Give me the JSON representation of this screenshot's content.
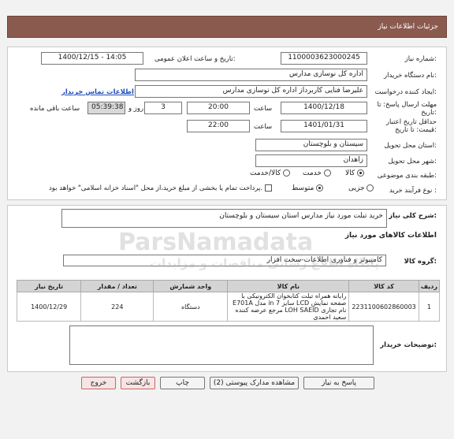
{
  "header": {
    "title": "جزئیات اطلاعات نیاز"
  },
  "form": {
    "need_number_label": "شماره نیاز:",
    "need_number": "1100003623000245",
    "announce_label": "تاریخ و ساعت اعلان عمومی:",
    "announce_value": "1400/12/15 - 14:05",
    "buyer_org_label": "نام دستگاه خریدار:",
    "buyer_org": "اداره کل نوسازی مدارس",
    "requester_label": "ایجاد کننده درخواست:",
    "requester": "علیرضا فنایی کاربرداز اداره کل نوسازی مدارس",
    "contact_link": "اطلاعات تماس خریدار",
    "deadline_label_1": "مهلت ارسال پاسخ: تا",
    "deadline_label_2": "تاریخ:",
    "deadline_date": "1400/12/18",
    "time_label": "ساعت",
    "deadline_time": "20:00",
    "days_value": "3",
    "days_and": "روز و",
    "remaining_time": "05:39:38",
    "remaining_label": "ساعت باقی مانده",
    "validity_label_1": "حداقل تاریخ اعتبار",
    "validity_label_2": "قیمت: تا تاریخ:",
    "validity_date": "1401/01/31",
    "validity_time": "22:00",
    "province_label": "استان محل تحویل:",
    "province": "سیستان و بلوچستان",
    "city_label": "شهر محل تحویل:",
    "city": "زاهدان",
    "category_label": "طبقه بندی موضوعی:",
    "category_options": [
      "کالا",
      "خدمت",
      "کالا/خدمت"
    ],
    "process_label": "نوع فرآیند خرید :",
    "process_options": [
      "جزیی",
      "متوسط"
    ],
    "payment_note": "پرداخت تمام یا بخشی از مبلغ خرید،از محل \"اسناد خزانه اسلامی\" خواهد بود."
  },
  "summary": {
    "label": "شرح کلی نیاز:",
    "text": "خرید تبلت مورد نیاز مدارس استان سیستان و بلوچستان"
  },
  "goods": {
    "section_title": "اطلاعات کالاهای مورد نیاز",
    "group_label": "گروه کالا:",
    "group_value": "کامپیوتر و فناوری اطلاعات-سخت افزار",
    "columns": [
      "ردیف",
      "کد کالا",
      "نام کالا",
      "واحد شمارش",
      "تعداد / مقدار",
      "تاریخ نیاز"
    ],
    "rows": [
      {
        "index": "1",
        "code": "2231100602860003",
        "name": "رایانه همراه تبلت کتابخوان الکترونیکی با صفحه نمایش LCD سایز 7 in مدل E701A نام تجاری LOH SAEID مرجع عرضه کننده سعید احمدی",
        "unit": "دستگاه",
        "qty": "224",
        "date": "1400/12/29"
      }
    ]
  },
  "buyer_notes": {
    "label": "توضیحات خریدار:"
  },
  "buttons": {
    "reply": "پاسخ به نیاز",
    "docs": "مشاهده مدارک پیوستی (2)",
    "print": "چاپ",
    "back": "بازگشت",
    "exit": "خروج"
  },
  "watermark": {
    "brand": "ParsNamadata",
    "sub": "پایگاه اطلاع رسانی مناقصات و مزایدات"
  }
}
